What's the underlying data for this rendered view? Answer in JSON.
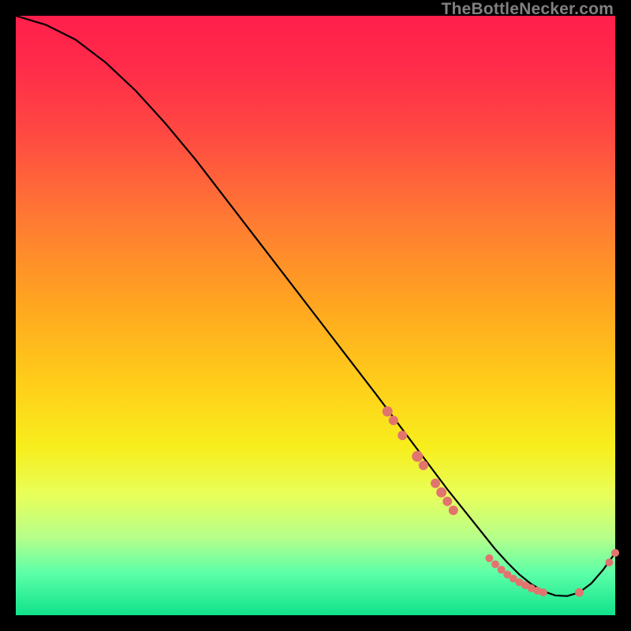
{
  "watermark": "TheBottleNecker.com",
  "chart_data": {
    "type": "line",
    "title": "",
    "xlabel": "",
    "ylabel": "",
    "x_range": [
      0,
      100
    ],
    "y_range": [
      0,
      100
    ],
    "series": [
      {
        "name": "curve",
        "x": [
          0,
          5,
          10,
          15,
          20,
          25,
          30,
          35,
          40,
          45,
          50,
          55,
          60,
          63,
          66,
          69,
          72,
          74,
          76,
          78,
          80,
          82,
          84,
          86,
          88,
          90,
          92,
          94,
          96,
          98,
          100
        ],
        "y": [
          100,
          98.5,
          96,
          92.2,
          87.5,
          82,
          76,
          69.5,
          63,
          56.5,
          50,
          43.5,
          37,
          33,
          29,
          25,
          21,
          18.5,
          16,
          13.5,
          11,
          8.8,
          6.8,
          5.2,
          4,
          3.3,
          3.2,
          3.8,
          5.3,
          7.6,
          10.4
        ]
      }
    ],
    "markers": [
      {
        "x": 62,
        "y": 34,
        "size": 6.5
      },
      {
        "x": 63,
        "y": 32.5,
        "size": 6
      },
      {
        "x": 64.5,
        "y": 30,
        "size": 6
      },
      {
        "x": 67,
        "y": 26.5,
        "size": 7
      },
      {
        "x": 68,
        "y": 25,
        "size": 6
      },
      {
        "x": 70,
        "y": 22,
        "size": 6
      },
      {
        "x": 71,
        "y": 20.5,
        "size": 6.5
      },
      {
        "x": 72,
        "y": 19,
        "size": 6
      },
      {
        "x": 73,
        "y": 17.5,
        "size": 6
      },
      {
        "x": 79,
        "y": 9.5,
        "size": 5
      },
      {
        "x": 80,
        "y": 8.5,
        "size": 5
      },
      {
        "x": 81,
        "y": 7.6,
        "size": 5
      },
      {
        "x": 82,
        "y": 6.8,
        "size": 5
      },
      {
        "x": 83,
        "y": 6.1,
        "size": 5
      },
      {
        "x": 84,
        "y": 5.5,
        "size": 5
      },
      {
        "x": 85,
        "y": 5.0,
        "size": 5
      },
      {
        "x": 86,
        "y": 4.5,
        "size": 5
      },
      {
        "x": 87,
        "y": 4.1,
        "size": 5
      },
      {
        "x": 88,
        "y": 3.8,
        "size": 5
      },
      {
        "x": 94,
        "y": 3.8,
        "size": 5.5
      },
      {
        "x": 99,
        "y": 8.8,
        "size": 5
      },
      {
        "x": 100,
        "y": 10.4,
        "size": 5
      }
    ],
    "gradient_stops": [
      {
        "pos": 0,
        "color": "#ff1f4b"
      },
      {
        "pos": 50,
        "color": "#ffd01a"
      },
      {
        "pos": 80,
        "color": "#e8ff5a"
      },
      {
        "pos": 100,
        "color": "#10e28a"
      }
    ]
  }
}
